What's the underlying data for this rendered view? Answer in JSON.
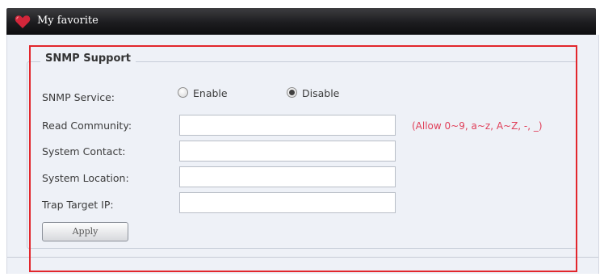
{
  "window": {
    "title": "My favorite"
  },
  "snmp": {
    "section_title": "SNMP Support",
    "service": {
      "label": "SNMP Service:",
      "options": [
        "Enable",
        "Disable"
      ],
      "selected": "Disable"
    },
    "read_community": {
      "label": "Read Community:",
      "value": "",
      "hint": "(Allow 0~9, a~z, A~Z, -, _)"
    },
    "system_contact": {
      "label": "System Contact:",
      "value": ""
    },
    "system_location": {
      "label": "System Location:",
      "value": ""
    },
    "trap_target_ip": {
      "label": "Trap Target IP:",
      "value": ""
    },
    "apply_label": "Apply"
  },
  "colors": {
    "highlight": "#e2262c",
    "hint": "#e0405a",
    "titlebar": "#1c1c1f"
  },
  "icons": {
    "title_icon": "heart-icon"
  }
}
